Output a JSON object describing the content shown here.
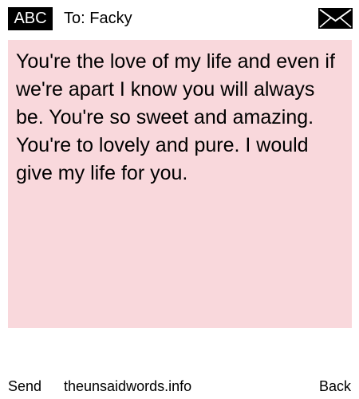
{
  "header": {
    "badge_label": "ABC",
    "recipient": "To: Facky",
    "action_icon": "envelope-icon"
  },
  "message": {
    "body": "You're the love of my life and even if we're apart I know you will always be. You're so sweet and amazing. You're to lovely and pure. I would give my life for you."
  },
  "footer": {
    "send_label": "Send",
    "site_label": "theunsaidwords.info",
    "back_label": "Back"
  },
  "colors": {
    "message_background": "#f9d8dc",
    "text": "#000000",
    "badge_background": "#000000",
    "badge_text": "#ffffff"
  }
}
